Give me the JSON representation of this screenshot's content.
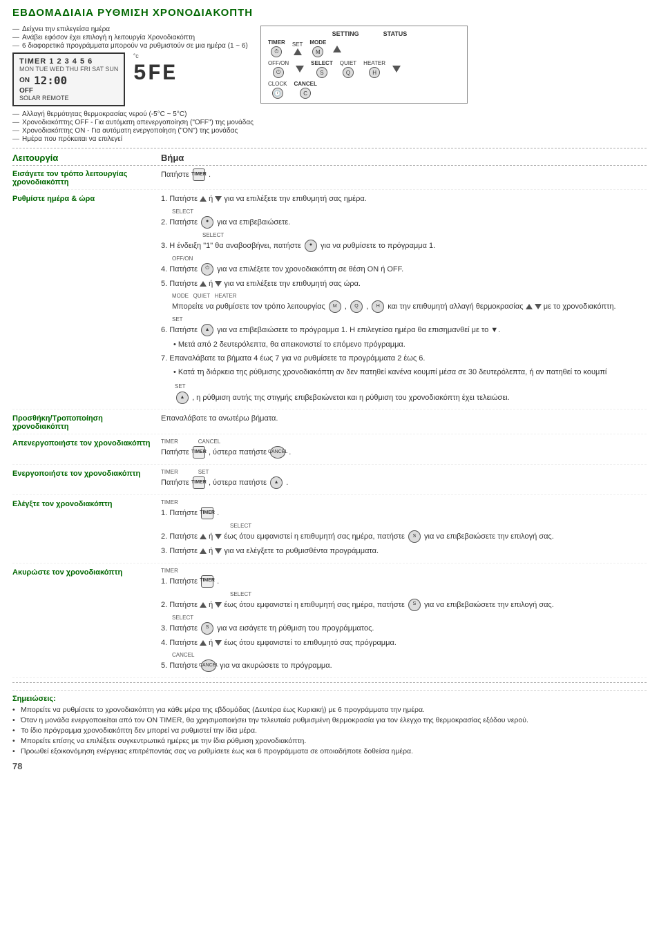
{
  "title": "ΕΒΔΟΜΑΔΙΑΙΑ ΡΥΘΜΙΣΗ ΧΡΟΝΟΔΙΑΚΟΠΤΗ",
  "topDiagram": {
    "arrows": [
      "Δείχνει την επιλεγείσα ημέρα",
      "Ανάβει εφόσον έχει επιλογή η λειτουργία Χρονοδιακόπτη",
      "6 διαφορετικά προγράμματα μπορούν να ρυθμιστούν σε μια ημέρα (1 ~ 6)"
    ],
    "timerDisplay": "TIMER 1 2 3 4 5 6",
    "dayLine": "MON TUE WED THU FRI SAT SUN",
    "onLine": "ON",
    "offLine": "OFF",
    "solarRemote": "SOLAR   REMOTE",
    "lcd1": "12:00",
    "lcd2": "5FE",
    "degreeC": "°c",
    "arrows2": [
      "Αλλαγή θερμότητας θερμοκρασίας νερού (-5°C ~ 5°C)",
      "Χρονοδιακόπτης OFF - Για αυτόματη απενεργοποίηση (\"OFF\") της μονάδας",
      "Χρονοδιακόπτης ON - Για αυτόματη ενεργοποίηση (\"ON\") της μονάδας",
      "Ημέρα που πρόκειται να επιλεγεί"
    ],
    "panel": {
      "settingLabel": "SETTING",
      "statusLabel": "STATUS",
      "timerLabel": "TIMER",
      "setLabel": "SET",
      "modeLabel": "MODE",
      "offOnLabel": "OFF/ON",
      "selectLabel": "SELECT",
      "quietLabel": "QUIET",
      "heaterLabel": "HEATER",
      "clockLabel": "CLOCK",
      "cancelLabel": "CANCEL"
    }
  },
  "tableHeader": {
    "col1": "Λειτουργία",
    "col2": "Βήμα"
  },
  "sections": [
    {
      "id": "eisagoge",
      "leitourgia": "Εισάγετε τον τρόπο λειτουργίας χρονοδιακόπτη",
      "steps": [
        {
          "num": "",
          "text": "Πατήστε [TIMER]."
        }
      ]
    },
    {
      "id": "rythmisi",
      "leitourgia": "Ρυθμίστε ημέρα & ώρα",
      "steps": [
        {
          "num": "1.",
          "text": "Πατήστε [▲] ή [▼] για να επιλέξετε την επιθυμητή σας ημέρα."
        },
        {
          "num": "2.",
          "text": "Πατήστε [SELECT] για να επιβεβαιώσετε."
        },
        {
          "num": "3.",
          "text": "Η ένδειξη \"1\" θα αναβοσβήνει, πατήστε [SELECT] για να ρυθμίσετε το πρόγραμμα 1."
        },
        {
          "num": "4.",
          "text": "Πατήστε [OFF/ON] για να επιλέξετε τον χρονοδιακόπτη σε θέση ON ή OFF."
        },
        {
          "num": "5.",
          "text": "Πατήστε [▲] ή [▼] για να επιλέξετε την επιθυμητή σας ώρα."
        },
        {
          "num": "",
          "text": "Μπορείτε να ρυθμίσετε τον τρόπο λειτουργίας [MODE], [QUIET], [HEATER] και την επιθυμητή αλλαγή θερμοκρασίας [▲] [▼] με το χρονοδιακόπτη."
        },
        {
          "num": "6.",
          "text": "Πατήστε [SET] για να επιβεβαιώσετε το πρόγραμμα 1. Η επιλεγείσα ημέρα θα επισημανθεί με το ▼."
        },
        {
          "num": "",
          "text": "• Μετά από 2 δευτερόλεπτα, θα απεικονιστεί το επόμενο πρόγραμμα."
        },
        {
          "num": "7.",
          "text": "Επαναλάβατε τα βήματα 4 έως 7 για να ρυθμίσετε τα προγράμματα 2 έως 6."
        },
        {
          "num": "",
          "text": "• Κατά τη διάρκεια της ρύθμισης χρονοδιακόπτη αν δεν πατηθεί κανένα κουμπί μέσα σε 30 δευτερόλεπτα, ή αν πατηθεί το κουμπί [SET], η ρύθμιση αυτής της στιγμής επιβεβαιώνεται και η ρύθμιση του χρονοδιακόπτη έχει τελειώσει."
        }
      ]
    },
    {
      "id": "prosthiki",
      "leitourgia": "Προσθήκη/Τροποποίηση χρονοδιακόπτη",
      "steps": [
        {
          "num": "",
          "text": "Επαναλάβατε τα ανωτέρω βήματα."
        }
      ]
    },
    {
      "id": "apenergopoiisi",
      "leitourgia": "Απενεργοποιήστε τον χρονοδιακόπτη",
      "steps": [
        {
          "num": "",
          "text": "Πατήστε [TIMER], ύστερα πατήστε [CANCEL]."
        }
      ]
    },
    {
      "id": "energopoiisi",
      "leitourgia": "Ενεργοποιήστε τον χρονοδιακόπτη",
      "steps": [
        {
          "num": "",
          "text": "Πατήστε [TIMER], ύστερα πατήστε [SET]."
        }
      ]
    },
    {
      "id": "elegxos",
      "leitourgia": "Ελέγξτε τον χρονοδιακόπτη",
      "steps": [
        {
          "num": "1.",
          "text": "Πατήστε [TIMER]."
        },
        {
          "num": "2.",
          "text": "Πατήστε [▲] ή [▼] έως ότου εμφανιστεί η επιθυμητή σας ημέρα, πατήστε [SELECT] για να επιβεβαιώσετε την επιλογή σας."
        },
        {
          "num": "3.",
          "text": "Πατήστε [▲] ή [▼] για να ελέγξετε τα ρυθμισθέντα προγράμματα."
        }
      ]
    },
    {
      "id": "akyrosi",
      "leitourgia": "Ακυρώστε τον χρονοδιακόπτη",
      "steps": [
        {
          "num": "1.",
          "text": "Πατήστε [TIMER]."
        },
        {
          "num": "2.",
          "text": "Πατήστε [▲] ή [▼] έως ότου εμφανιστεί η επιθυμητή σας ημέρα, πατήστε [SELECT] για να επιβεβαιώσετε την επιλογή σας."
        },
        {
          "num": "3.",
          "text": "Πατήστε [SELECT] για να εισάγετε τη ρύθμιση του προγράμματος."
        },
        {
          "num": "4.",
          "text": "Πατήστε [▲] ή [▼] έως ότου εμφανιστεί το επιθυμητό σας πρόγραμμα."
        },
        {
          "num": "5.",
          "text": "Πατήστε [CANCEL] για να ακυρώσετε το πρόγραμμα."
        }
      ]
    }
  ],
  "notes": {
    "title": "Σημειώσεις:",
    "items": [
      "Μπορείτε να ρυθμίσετε το χρονοδιακόπτη για κάθε μέρα της εβδομάδας (Δευτέρα έως Κυριακή) με 6 προγράμματα την ημέρα.",
      "Όταν η μονάδα ενεργοποιείται από τον ON TIMER, θα χρησιμοποιήσει την τελευταία ρυθμισμένη θερμοκρασία για τον έλεγχο της θερμοκρασίας εξόδου νερού.",
      "Το ίδιο πρόγραμμα χρονοδιακόπτη δεν μπορεί να ρυθμιστεί την ίδια μέρα.",
      "Μπορείτε επίσης να επιλέξετε συγκεντρωτικά ημέρες με την ίδια ρύθμιση χρονοδιακόπτη.",
      "Προωθεί εξοικονόμηση ενέργειας επιτρέποντάς σας να ρυθμίσετε έως και 6 προγράμματα σε οποιαδήποτε δοθείσα ημέρα."
    ]
  },
  "pageNumber": "78"
}
